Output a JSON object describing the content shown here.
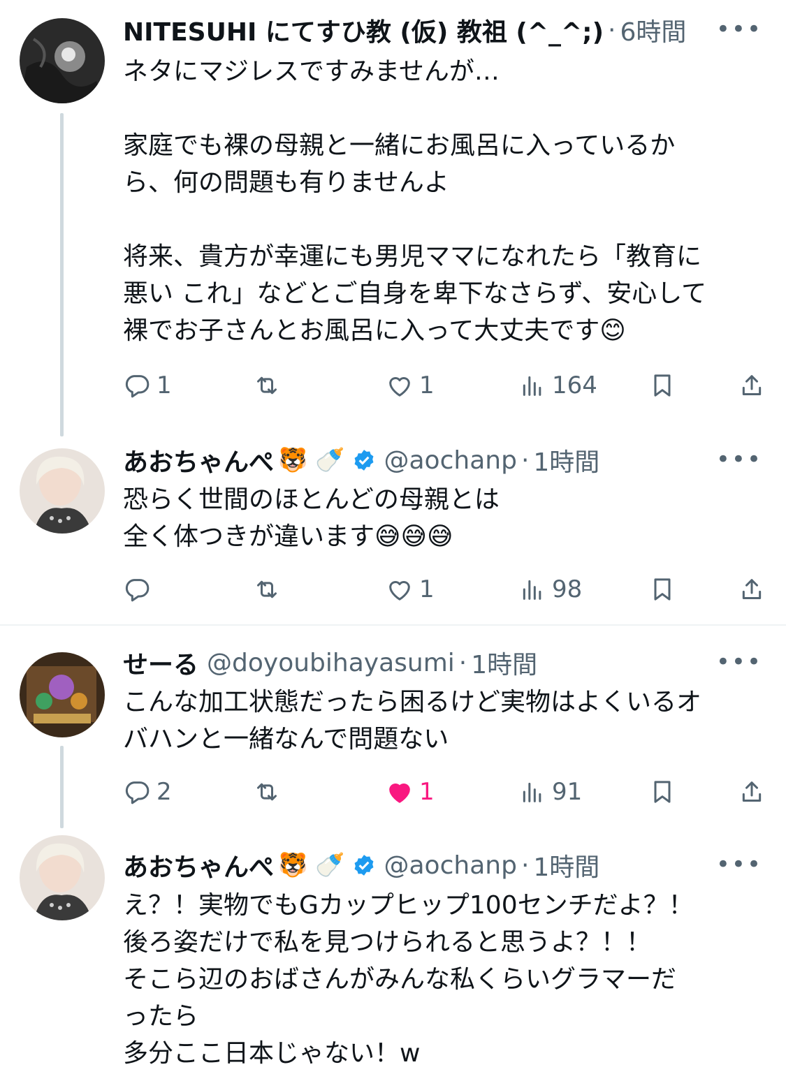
{
  "tweets": [
    {
      "name": "NITESUHI にてすひ教 (仮) 教祖 (^_^;)",
      "emoji": "",
      "handle": "",
      "time": "6時間",
      "more": "•••",
      "body": "ネタにマジレスですみませんが…\n\n家庭でも裸の母親と一緒にお風呂に入っているか\nら、何の問題も有りませんよ\n\n将来、貴方が幸運にも男児ママになれたら「教育に\n悪い これ」などとご自身を卑下なさらず、安心して\n裸でお子さんとお風呂に入って大丈夫です😊",
      "replies": "1",
      "retweets": "",
      "likes": "1",
      "views": "164"
    },
    {
      "name": "あおちゃんぺ",
      "emoji": "🐯 🍼",
      "handle": "@aochanp",
      "time": "1時間",
      "more": "•••",
      "body": "恐らく世間のほとんどの母親とは\n全く体つきが違います😅😅😅",
      "replies": "",
      "retweets": "",
      "likes": "1",
      "views": "98"
    },
    {
      "name": "せーる",
      "emoji": "",
      "handle": "@doyoubihayasumi",
      "time": "1時間",
      "more": "•••",
      "body": "こんな加工状態だったら困るけど実物はよくいるオ\nバハンと一緒なんで問題ない",
      "replies": "2",
      "retweets": "",
      "likes": "1",
      "views": "91"
    },
    {
      "name": "あおちゃんぺ",
      "emoji": "🐯 🍼",
      "handle": "@aochanp",
      "time": "1時間",
      "more": "•••",
      "body": "え？！実物でもGカップヒップ100センチだよ？！\n後ろ姿だけで私を見つけられると思うよ？！！\nそこら辺のおばさんがみんな私くらいグラマーだ\nったら\n多分ここ日本じゃない！w",
      "replies": "",
      "retweets": "",
      "likes": "",
      "views": ""
    }
  ],
  "dot": "·",
  "colors": {
    "like_active": "#f91880",
    "verified": "#1d9bf0",
    "muted": "#536471"
  },
  "icons": [
    "reply-icon",
    "retweet-icon",
    "like-icon",
    "views-icon",
    "bookmark-icon",
    "share-icon",
    "verified-icon",
    "more-icon"
  ]
}
